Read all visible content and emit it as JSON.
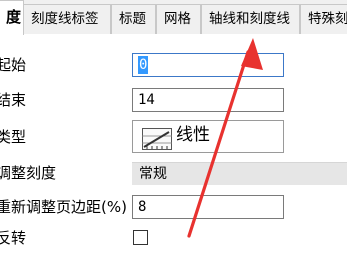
{
  "tabs": [
    {
      "label": "度",
      "active": true
    },
    {
      "label": "刻度线标签",
      "active": false
    },
    {
      "label": "标题",
      "active": false
    },
    {
      "label": "网格",
      "active": false
    },
    {
      "label": "轴线和刻度线",
      "active": false
    },
    {
      "label": "特殊刻",
      "active": false
    }
  ],
  "properties": {
    "start": {
      "label": "起始",
      "value": "0"
    },
    "end": {
      "label": "结束",
      "value": "14"
    },
    "type": {
      "label": "类型",
      "value": "线性",
      "icon": "linear-scale-icon"
    },
    "rescale": {
      "label": "调整刻度",
      "value": "常规"
    },
    "rescale_margin": {
      "label": "重新调整页边距(%)",
      "value": "8"
    },
    "reverse": {
      "label": "反转",
      "checked": false
    }
  },
  "annotation": {
    "color": "#e8322f",
    "icon": "red-arrow-pointer"
  }
}
